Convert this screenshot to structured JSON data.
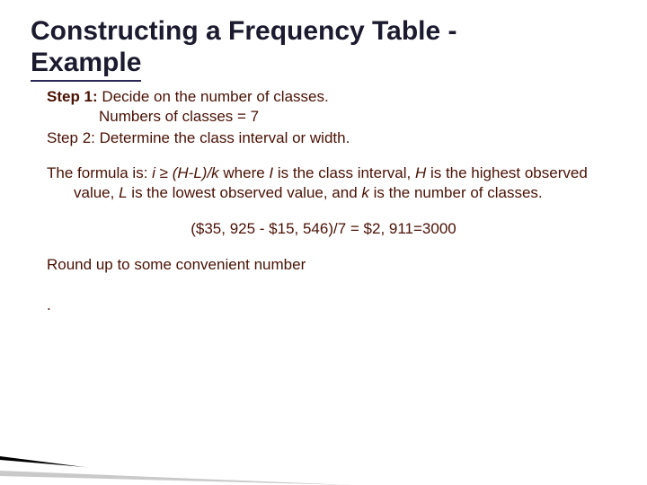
{
  "title_line1": "Constructing a Frequency Table -",
  "title_line2": "Example",
  "step1_label": "Step 1:",
  "step1_text": " Decide on the number of classes.",
  "step1_sub": "Numbers of classes  = 7",
  "step2": "Step 2: Determine the class interval or width.",
  "formula_pre": "The formula is: ",
  "formula_i": "i ",
  "formula_ge": "≥",
  "formula_hlk": " (H-L)/k",
  "formula_where": " where ",
  "formula_Ivar": "I",
  "formula_Idef": " is the class interval, ",
  "formula_Hvar": "H",
  "formula_Hdef": " is the highest observed value, ",
  "formula_Lvar": "L",
  "formula_Ldef": " is the lowest observed value, and ",
  "formula_kvar": "k",
  "formula_kdef": " is the number of classes.",
  "equation": "($35, 925 - $15, 546)/7 = $2, 911=3000",
  "round_note": "Round up to some convenient number",
  "dot": "."
}
